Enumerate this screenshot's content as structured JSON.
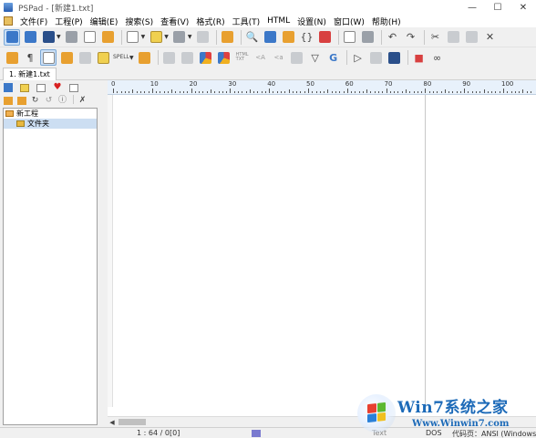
{
  "window": {
    "title": "PSPad - [新建1.txt]",
    "controls": {
      "minimize": "—",
      "maximize": "☐",
      "close": "✕"
    }
  },
  "menu": [
    "文件(F)",
    "工程(P)",
    "编辑(E)",
    "搜索(S)",
    "查看(V)",
    "格式(R)",
    "工具(T)",
    "HTML",
    "设置(N)",
    "窗口(W)",
    "帮助(H)"
  ],
  "toolbar2": {
    "spell_label": "SPELL",
    "html_label": "HTML\nTXT"
  },
  "tabs": [
    {
      "label": "1. 新建1.txt"
    }
  ],
  "project_tree": {
    "root": "新工程",
    "children": [
      "文件夹"
    ]
  },
  "ruler": {
    "labels": [
      "0",
      "10",
      "20",
      "30",
      "40",
      "50",
      "60",
      "70",
      "80",
      "90",
      "100"
    ]
  },
  "statusbar": {
    "position": "1 : 64 / 0",
    "selection": "[0]",
    "syntax": "Text",
    "line_end": "DOS",
    "encoding": "代码页：ANSI (Windows)"
  },
  "watermark": {
    "brand": "Win7系统之家",
    "site": "Www.Winwin7.com"
  },
  "colors": {
    "accent": "#3c78c8",
    "ruler_bg": "#e8f1fb",
    "watermark": "#1c6ab8"
  }
}
